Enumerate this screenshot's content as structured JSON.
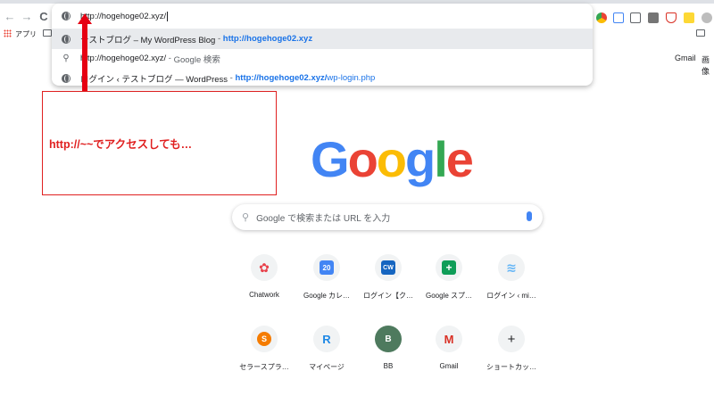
{
  "toolbar": {
    "back_icon": "←",
    "forward_icon": "→",
    "reload_icon": "C"
  },
  "omnibox": {
    "input_value": "http://hogehoge02.xyz/",
    "suggestions": [
      {
        "icon": "globe-icon",
        "title": "テストブログ – My WordPress Blog",
        "sep": " - ",
        "url_bold": "http://hogehoge02.xyz",
        "url_rest": ""
      },
      {
        "icon": "search-icon",
        "title": "http://hogehoge02.xyz/",
        "sep": " - ",
        "url_bold": "",
        "url_rest": "Google 検索"
      },
      {
        "icon": "globe-icon",
        "title": "ログイン ‹ テストブログ — WordPress",
        "sep": " - ",
        "url_bold": "http://hogehoge02.xyz/",
        "url_rest": "wp-login.php"
      }
    ]
  },
  "bookmarks": {
    "apps_label": "アプリ"
  },
  "header": {
    "gmail": "Gmail",
    "images": "画像"
  },
  "annotation": {
    "text": "http://~~でアクセスしても…",
    "color": "#e02020"
  },
  "logo": {
    "letters": [
      "G",
      "o",
      "o",
      "g",
      "l",
      "e"
    ],
    "colors": [
      "#4285f4",
      "#ea4335",
      "#fbbc05",
      "#4285f4",
      "#34a853",
      "#ea4335"
    ]
  },
  "search": {
    "placeholder": "Google で検索または URL を入力"
  },
  "shortcuts": [
    {
      "label": "Chatwork",
      "glyph": "✿",
      "color": "#e8404a"
    },
    {
      "label": "Google カレ…",
      "glyph": "20",
      "color": "#4285f4"
    },
    {
      "label": "ログイン【ク…",
      "glyph": "CW",
      "color": "#1565c0"
    },
    {
      "label": "Google スプ…",
      "glyph": "+",
      "color": "#0f9d58"
    },
    {
      "label": "ログイン ‹ mi…",
      "glyph": "≋",
      "color": "#64b5f6"
    },
    {
      "label": "セラースプラ…",
      "glyph": "S",
      "color": "#f57c00"
    },
    {
      "label": "マイページ",
      "glyph": "R",
      "color": "#1e88e5"
    },
    {
      "label": "BB",
      "glyph": "B",
      "color": "#4e7a5e"
    },
    {
      "label": "Gmail",
      "glyph": "M",
      "color": "#d93025"
    },
    {
      "label": "ショートカッ…",
      "glyph": "+",
      "color": "#202124"
    }
  ]
}
